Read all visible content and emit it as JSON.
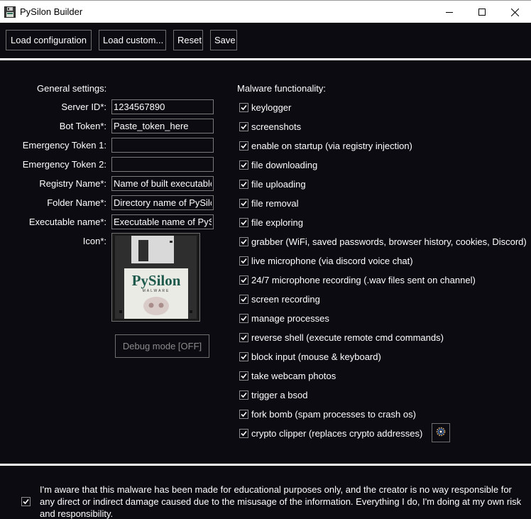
{
  "window": {
    "title": "PySilon Builder",
    "app_icon": "floppy-disk-icon",
    "controls": {
      "minimize": "minimize-icon",
      "maximize": "maximize-icon",
      "close": "close-icon"
    }
  },
  "toolbar": {
    "load_configuration_label": "Load configuration",
    "load_custom_label": "Load custom...",
    "reset_label": "Reset",
    "save_label": "Save"
  },
  "general": {
    "heading": "General settings:",
    "fields": [
      {
        "label": "Server ID*:",
        "value": "1234567890"
      },
      {
        "label": "Bot Token*:",
        "value": "Paste_token_here"
      },
      {
        "label": "Emergency Token 1:",
        "value": ""
      },
      {
        "label": "Emergency Token 2:",
        "value": ""
      },
      {
        "label": "Registry Name*:",
        "value": "Name of built executable"
      },
      {
        "label": "Folder Name*:",
        "value": "Directory name of PySilon"
      },
      {
        "label": "Executable name*:",
        "value": "Executable name of PySilon"
      }
    ],
    "icon_label": "Icon*:",
    "icon_image": {
      "title": "PySilon",
      "subtitle": "MALWARE"
    },
    "debug_button_label": "Debug mode [OFF]"
  },
  "features": {
    "heading": "Malware functionality:",
    "items": [
      {
        "label": "keylogger",
        "checked": true
      },
      {
        "label": "screenshots",
        "checked": true
      },
      {
        "label": "enable on startup (via registry injection)",
        "checked": true
      },
      {
        "label": "file downloading",
        "checked": true
      },
      {
        "label": "file uploading",
        "checked": true
      },
      {
        "label": "file removal",
        "checked": true
      },
      {
        "label": "file exploring",
        "checked": true
      },
      {
        "label": "grabber (WiFi, saved passwords, browser history, cookies, Discord)",
        "checked": true
      },
      {
        "label": "live microphone (via discord voice chat)",
        "checked": true
      },
      {
        "label": "24/7 microphone recording (.wav files sent on channel)",
        "checked": true
      },
      {
        "label": "screen recording",
        "checked": true
      },
      {
        "label": "manage processes",
        "checked": true
      },
      {
        "label": "reverse shell (execute remote cmd commands)",
        "checked": true
      },
      {
        "label": "block input (mouse & keyboard)",
        "checked": true
      },
      {
        "label": "take webcam photos",
        "checked": true
      },
      {
        "label": "trigger a bsod",
        "checked": true
      },
      {
        "label": "fork bomb (spam processes to crash os)",
        "checked": true
      },
      {
        "label": "crypto clipper (replaces crypto addresses)",
        "checked": true
      }
    ],
    "crypto_settings_icon": "gear-icon"
  },
  "acknowledgement": {
    "checked": true,
    "text": "I'm aware that this malware has been made for educational purposes only, and the creator is no way responsible for any direct or indirect damage caused due to the misusage of the information. Everything I do, I'm doing at my own risk and responsibility."
  }
}
